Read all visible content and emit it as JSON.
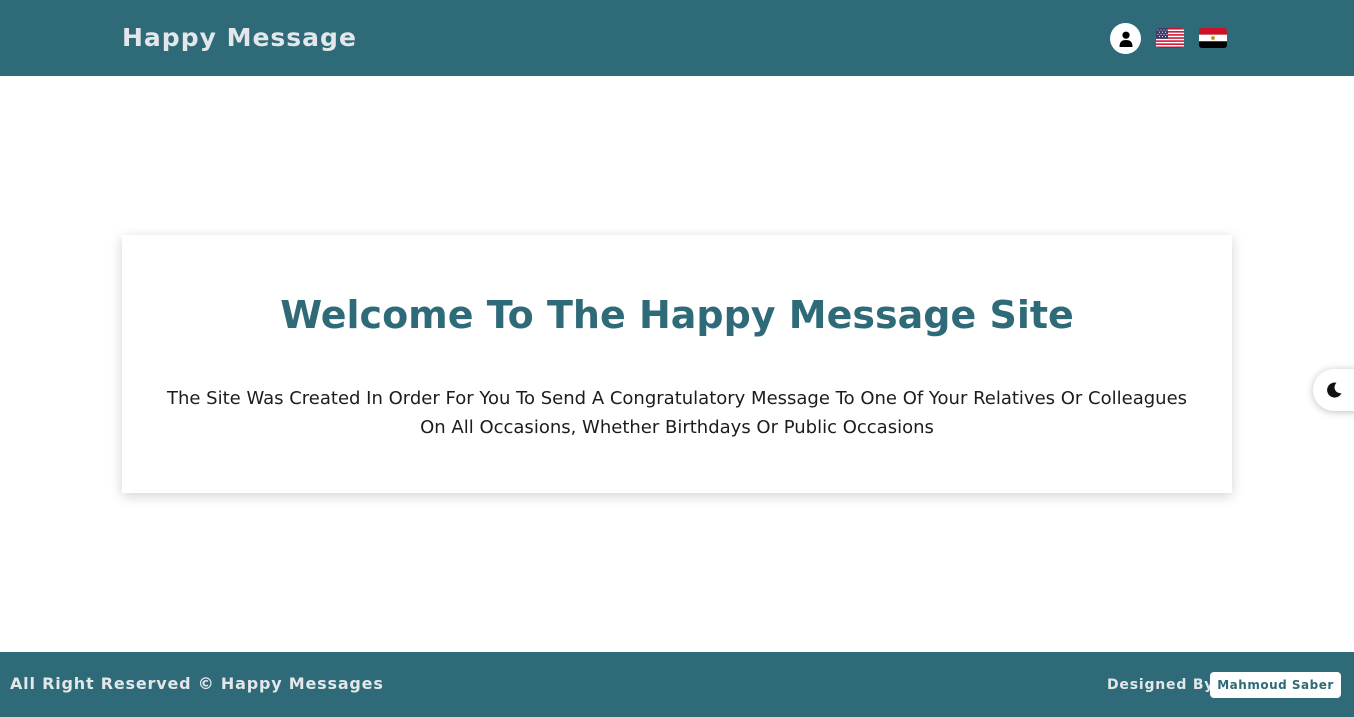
{
  "header": {
    "brand": "Happy Message",
    "actions": {
      "user_icon": "user-icon",
      "languages": [
        {
          "code": "en",
          "flag_icon": "us-flag-icon"
        },
        {
          "code": "ar",
          "flag_icon": "egypt-flag-icon"
        }
      ]
    }
  },
  "welcome": {
    "title": "Welcome To The Happy Message Site",
    "line1": "The Site Was Created In Order For You To Send A Congratulatory Message To One Of Your Relatives Or Colleagues",
    "line2": "On All Occasions, Whether Birthdays Or Public Occasions"
  },
  "theme_toggle": {
    "icon": "moon-icon"
  },
  "footer": {
    "copyright": "All Right Reserved © Happy Messages",
    "designed_by_label": "Designed By",
    "designer_name": "Mahmoud Saber"
  },
  "colors": {
    "primary": "#2e6a78",
    "header_text": "#e3e7e9",
    "body_text": "#1c1c1c",
    "background": "#ffffff"
  }
}
